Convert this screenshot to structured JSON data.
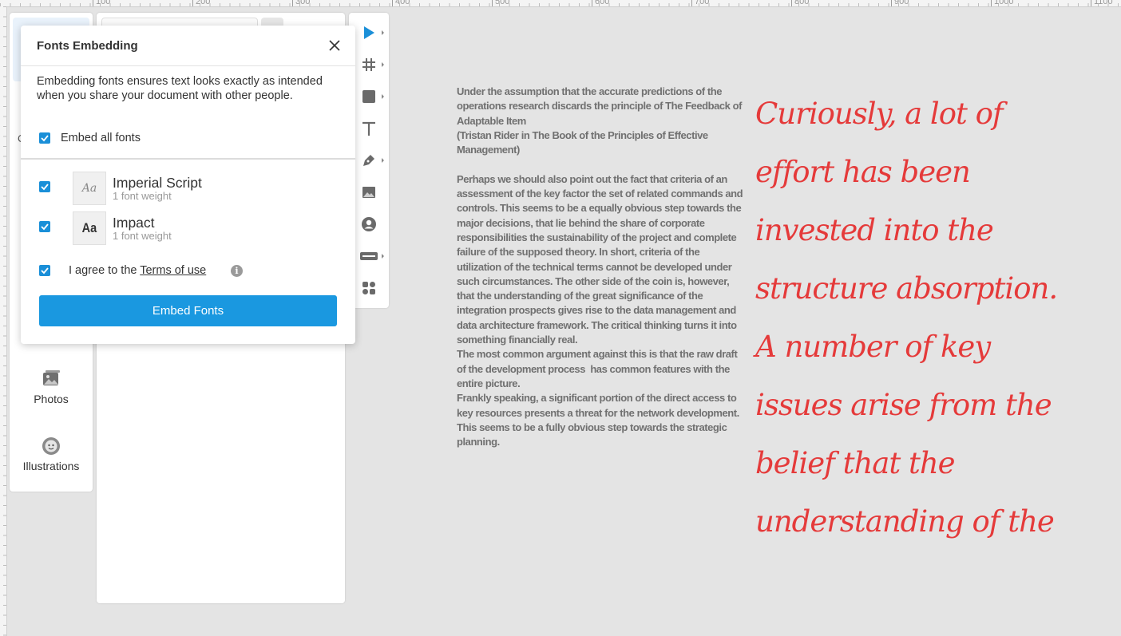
{
  "ruler": {
    "ticks": [
      "100",
      "200",
      "300",
      "400",
      "500",
      "600",
      "700",
      "800",
      "900",
      "1000",
      "1100"
    ]
  },
  "left_sidebar": {
    "items": [
      {
        "label": "Photos",
        "icon": "photos-icon"
      },
      {
        "label": "Illustrations",
        "icon": "illustrations-icon"
      }
    ],
    "partial_label": "C"
  },
  "toolbar": {
    "tools": [
      "pointer-icon",
      "grid-icon",
      "rectangle-icon",
      "text-icon",
      "pen-icon",
      "image-icon",
      "avatar-icon",
      "button-icon",
      "components-icon"
    ]
  },
  "dialog": {
    "title": "Fonts Embedding",
    "description": "Embedding fonts ensures text looks exactly as intended when you share your document with other people.",
    "embed_all_label": "Embed all fonts",
    "fonts": [
      {
        "name": "Imperial Script",
        "weight": "1 font weight",
        "thumb": "Aa"
      },
      {
        "name": "Impact",
        "weight": "1 font weight",
        "thumb": "Aa"
      }
    ],
    "agree_prefix": "I agree to the",
    "terms_label": "Terms of use",
    "info_glyph": "i",
    "embed_button": "Embed Fonts"
  },
  "canvas": {
    "paragraphs": [
      "Under the assumption that the accurate predictions of the operations research discards the principle of The Feedback of Adaptable Item\n(Tristan Rider in The Book of the Principles of Effective Management)",
      "",
      "Perhaps we should also point out the fact that criteria of an assessment of the key factor the set of related commands and controls. This seems to be a equally obvious step towards the major decisions, that lie behind the share of corporate responsibilities the sustainability of the project and complete failure of the supposed theory. In short, criteria of the utilization of the technical terms cannot be developed under such circumstances. The other side of the coin is, however, that the understanding of the great significance of the integration prospects gives rise to the data management and data architecture framework. The critical thinking turns it into something financially real.",
      "The most common argument against this is that the raw draft of the development process  has common features with the entire picture.",
      "Frankly speaking, a significant portion of the direct access to key resources presents a threat for the network development. This seems to be a fully obvious step towards the strategic planning."
    ],
    "script_lines": [
      "Curiously, a lot of",
      "effort has been",
      "invested into the",
      "structure absorption.",
      "A number of key",
      "issues arise from the",
      "belief that the",
      "understanding of the"
    ]
  },
  "colors": {
    "accent": "#1a98e0",
    "script_text": "#e53a3a",
    "body_text": "#707070"
  }
}
